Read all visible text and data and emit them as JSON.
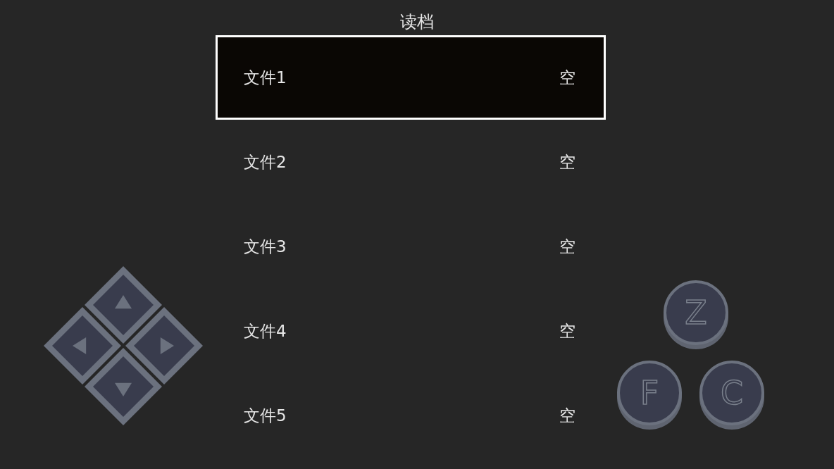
{
  "title": "读档",
  "slots": [
    {
      "name": "文件1",
      "status": "空",
      "selected": true
    },
    {
      "name": "文件2",
      "status": "空",
      "selected": false
    },
    {
      "name": "文件3",
      "status": "空",
      "selected": false
    },
    {
      "name": "文件4",
      "status": "空",
      "selected": false
    },
    {
      "name": "文件5",
      "status": "空",
      "selected": false
    }
  ],
  "action_buttons": [
    {
      "label": "Z"
    },
    {
      "label": "F"
    },
    {
      "label": "C"
    }
  ]
}
